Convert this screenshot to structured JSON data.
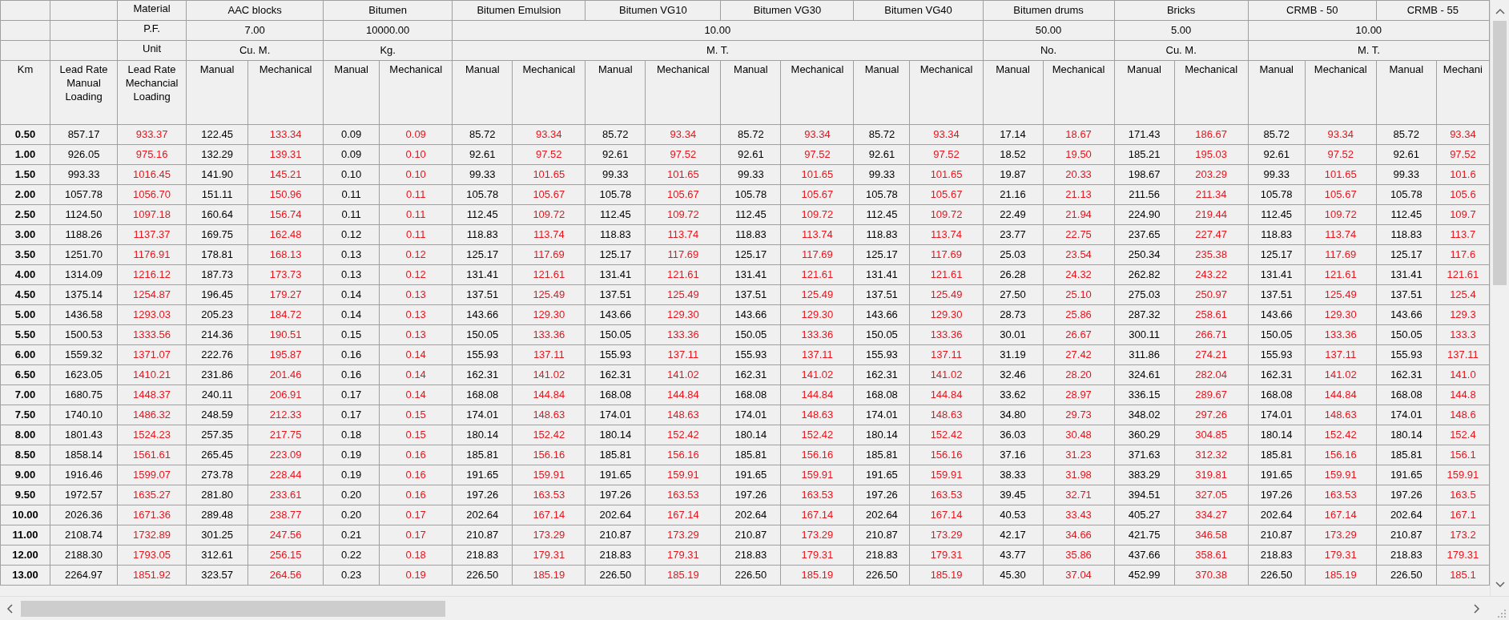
{
  "header_labels": {
    "material": "Material",
    "pf": "P.F.",
    "unit": "Unit"
  },
  "material_groups": [
    {
      "pf": "7.00",
      "unit": "Cu. M.",
      "materials": [
        {
          "name": "AAC blocks"
        }
      ]
    },
    {
      "pf": "10000.00",
      "unit": "Kg.",
      "materials": [
        {
          "name": "Bitumen"
        }
      ]
    },
    {
      "pf": "10.00",
      "unit": "M. T.",
      "materials": [
        {
          "name": "Bitumen Emulsion"
        },
        {
          "name": "Bitumen VG10"
        },
        {
          "name": "Bitumen VG30"
        },
        {
          "name": "Bitumen VG40"
        }
      ]
    },
    {
      "pf": "50.00",
      "unit": "No.",
      "materials": [
        {
          "name": "Bitumen drums"
        }
      ]
    },
    {
      "pf": "5.00",
      "unit": "Cu. M.",
      "materials": [
        {
          "name": "Bricks"
        }
      ]
    },
    {
      "pf": "10.00",
      "unit": "M. T.",
      "materials": [
        {
          "name": "CRMB - 50"
        },
        {
          "name": "CRMB - 55"
        }
      ]
    }
  ],
  "columns": [
    {
      "label": "Km",
      "kind": "key"
    },
    {
      "label": "Lead Rate Manual Loading",
      "kind": "manual"
    },
    {
      "label": "Lead Rate Mechancial Loading",
      "kind": "mechanical"
    },
    {
      "label": "Manual",
      "kind": "manual"
    },
    {
      "label": "Mechanical",
      "kind": "mechanical"
    },
    {
      "label": "Manual",
      "kind": "manual"
    },
    {
      "label": "Mechanical",
      "kind": "mechanical"
    },
    {
      "label": "Manual",
      "kind": "manual"
    },
    {
      "label": "Mechanical",
      "kind": "mechanical"
    },
    {
      "label": "Manual",
      "kind": "manual"
    },
    {
      "label": "Mechanical",
      "kind": "mechanical"
    },
    {
      "label": "Manual",
      "kind": "manual"
    },
    {
      "label": "Mechanical",
      "kind": "mechanical"
    },
    {
      "label": "Manual",
      "kind": "manual"
    },
    {
      "label": "Mechanical",
      "kind": "mechanical"
    },
    {
      "label": "Manual",
      "kind": "manual"
    },
    {
      "label": "Mechanical",
      "kind": "mechanical"
    },
    {
      "label": "Manual",
      "kind": "manual"
    },
    {
      "label": "Mechanical",
      "kind": "mechanical"
    },
    {
      "label": "Manual",
      "kind": "manual"
    },
    {
      "label": "Mechanical",
      "kind": "mechanical"
    },
    {
      "label": "Manual",
      "kind": "manual"
    },
    {
      "label": "Mechani",
      "kind": "mechanical"
    }
  ],
  "rows": [
    [
      "0.50",
      "857.17",
      "933.37",
      "122.45",
      "133.34",
      "0.09",
      "0.09",
      "85.72",
      "93.34",
      "85.72",
      "93.34",
      "85.72",
      "93.34",
      "85.72",
      "93.34",
      "17.14",
      "18.67",
      "171.43",
      "186.67",
      "85.72",
      "93.34",
      "85.72",
      "93.34"
    ],
    [
      "1.00",
      "926.05",
      "975.16",
      "132.29",
      "139.31",
      "0.09",
      "0.10",
      "92.61",
      "97.52",
      "92.61",
      "97.52",
      "92.61",
      "97.52",
      "92.61",
      "97.52",
      "18.52",
      "19.50",
      "185.21",
      "195.03",
      "92.61",
      "97.52",
      "92.61",
      "97.52"
    ],
    [
      "1.50",
      "993.33",
      "1016.45",
      "141.90",
      "145.21",
      "0.10",
      "0.10",
      "99.33",
      "101.65",
      "99.33",
      "101.65",
      "99.33",
      "101.65",
      "99.33",
      "101.65",
      "19.87",
      "20.33",
      "198.67",
      "203.29",
      "99.33",
      "101.65",
      "99.33",
      "101.6"
    ],
    [
      "2.00",
      "1057.78",
      "1056.70",
      "151.11",
      "150.96",
      "0.11",
      "0.11",
      "105.78",
      "105.67",
      "105.78",
      "105.67",
      "105.78",
      "105.67",
      "105.78",
      "105.67",
      "21.16",
      "21.13",
      "211.56",
      "211.34",
      "105.78",
      "105.67",
      "105.78",
      "105.6"
    ],
    [
      "2.50",
      "1124.50",
      "1097.18",
      "160.64",
      "156.74",
      "0.11",
      "0.11",
      "112.45",
      "109.72",
      "112.45",
      "109.72",
      "112.45",
      "109.72",
      "112.45",
      "109.72",
      "22.49",
      "21.94",
      "224.90",
      "219.44",
      "112.45",
      "109.72",
      "112.45",
      "109.7"
    ],
    [
      "3.00",
      "1188.26",
      "1137.37",
      "169.75",
      "162.48",
      "0.12",
      "0.11",
      "118.83",
      "113.74",
      "118.83",
      "113.74",
      "118.83",
      "113.74",
      "118.83",
      "113.74",
      "23.77",
      "22.75",
      "237.65",
      "227.47",
      "118.83",
      "113.74",
      "118.83",
      "113.7"
    ],
    [
      "3.50",
      "1251.70",
      "1176.91",
      "178.81",
      "168.13",
      "0.13",
      "0.12",
      "125.17",
      "117.69",
      "125.17",
      "117.69",
      "125.17",
      "117.69",
      "125.17",
      "117.69",
      "25.03",
      "23.54",
      "250.34",
      "235.38",
      "125.17",
      "117.69",
      "125.17",
      "117.6"
    ],
    [
      "4.00",
      "1314.09",
      "1216.12",
      "187.73",
      "173.73",
      "0.13",
      "0.12",
      "131.41",
      "121.61",
      "131.41",
      "121.61",
      "131.41",
      "121.61",
      "131.41",
      "121.61",
      "26.28",
      "24.32",
      "262.82",
      "243.22",
      "131.41",
      "121.61",
      "131.41",
      "121.61"
    ],
    [
      "4.50",
      "1375.14",
      "1254.87",
      "196.45",
      "179.27",
      "0.14",
      "0.13",
      "137.51",
      "125.49",
      "137.51",
      "125.49",
      "137.51",
      "125.49",
      "137.51",
      "125.49",
      "27.50",
      "25.10",
      "275.03",
      "250.97",
      "137.51",
      "125.49",
      "137.51",
      "125.4"
    ],
    [
      "5.00",
      "1436.58",
      "1293.03",
      "205.23",
      "184.72",
      "0.14",
      "0.13",
      "143.66",
      "129.30",
      "143.66",
      "129.30",
      "143.66",
      "129.30",
      "143.66",
      "129.30",
      "28.73",
      "25.86",
      "287.32",
      "258.61",
      "143.66",
      "129.30",
      "143.66",
      "129.3"
    ],
    [
      "5.50",
      "1500.53",
      "1333.56",
      "214.36",
      "190.51",
      "0.15",
      "0.13",
      "150.05",
      "133.36",
      "150.05",
      "133.36",
      "150.05",
      "133.36",
      "150.05",
      "133.36",
      "30.01",
      "26.67",
      "300.11",
      "266.71",
      "150.05",
      "133.36",
      "150.05",
      "133.3"
    ],
    [
      "6.00",
      "1559.32",
      "1371.07",
      "222.76",
      "195.87",
      "0.16",
      "0.14",
      "155.93",
      "137.11",
      "155.93",
      "137.11",
      "155.93",
      "137.11",
      "155.93",
      "137.11",
      "31.19",
      "27.42",
      "311.86",
      "274.21",
      "155.93",
      "137.11",
      "155.93",
      "137.11"
    ],
    [
      "6.50",
      "1623.05",
      "1410.21",
      "231.86",
      "201.46",
      "0.16",
      "0.14",
      "162.31",
      "141.02",
      "162.31",
      "141.02",
      "162.31",
      "141.02",
      "162.31",
      "141.02",
      "32.46",
      "28.20",
      "324.61",
      "282.04",
      "162.31",
      "141.02",
      "162.31",
      "141.0"
    ],
    [
      "7.00",
      "1680.75",
      "1448.37",
      "240.11",
      "206.91",
      "0.17",
      "0.14",
      "168.08",
      "144.84",
      "168.08",
      "144.84",
      "168.08",
      "144.84",
      "168.08",
      "144.84",
      "33.62",
      "28.97",
      "336.15",
      "289.67",
      "168.08",
      "144.84",
      "168.08",
      "144.8"
    ],
    [
      "7.50",
      "1740.10",
      "1486.32",
      "248.59",
      "212.33",
      "0.17",
      "0.15",
      "174.01",
      "148.63",
      "174.01",
      "148.63",
      "174.01",
      "148.63",
      "174.01",
      "148.63",
      "34.80",
      "29.73",
      "348.02",
      "297.26",
      "174.01",
      "148.63",
      "174.01",
      "148.6"
    ],
    [
      "8.00",
      "1801.43",
      "1524.23",
      "257.35",
      "217.75",
      "0.18",
      "0.15",
      "180.14",
      "152.42",
      "180.14",
      "152.42",
      "180.14",
      "152.42",
      "180.14",
      "152.42",
      "36.03",
      "30.48",
      "360.29",
      "304.85",
      "180.14",
      "152.42",
      "180.14",
      "152.4"
    ],
    [
      "8.50",
      "1858.14",
      "1561.61",
      "265.45",
      "223.09",
      "0.19",
      "0.16",
      "185.81",
      "156.16",
      "185.81",
      "156.16",
      "185.81",
      "156.16",
      "185.81",
      "156.16",
      "37.16",
      "31.23",
      "371.63",
      "312.32",
      "185.81",
      "156.16",
      "185.81",
      "156.1"
    ],
    [
      "9.00",
      "1916.46",
      "1599.07",
      "273.78",
      "228.44",
      "0.19",
      "0.16",
      "191.65",
      "159.91",
      "191.65",
      "159.91",
      "191.65",
      "159.91",
      "191.65",
      "159.91",
      "38.33",
      "31.98",
      "383.29",
      "319.81",
      "191.65",
      "159.91",
      "191.65",
      "159.91"
    ],
    [
      "9.50",
      "1972.57",
      "1635.27",
      "281.80",
      "233.61",
      "0.20",
      "0.16",
      "197.26",
      "163.53",
      "197.26",
      "163.53",
      "197.26",
      "163.53",
      "197.26",
      "163.53",
      "39.45",
      "32.71",
      "394.51",
      "327.05",
      "197.26",
      "163.53",
      "197.26",
      "163.5"
    ],
    [
      "10.00",
      "2026.36",
      "1671.36",
      "289.48",
      "238.77",
      "0.20",
      "0.17",
      "202.64",
      "167.14",
      "202.64",
      "167.14",
      "202.64",
      "167.14",
      "202.64",
      "167.14",
      "40.53",
      "33.43",
      "405.27",
      "334.27",
      "202.64",
      "167.14",
      "202.64",
      "167.1"
    ],
    [
      "11.00",
      "2108.74",
      "1732.89",
      "301.25",
      "247.56",
      "0.21",
      "0.17",
      "210.87",
      "173.29",
      "210.87",
      "173.29",
      "210.87",
      "173.29",
      "210.87",
      "173.29",
      "42.17",
      "34.66",
      "421.75",
      "346.58",
      "210.87",
      "173.29",
      "210.87",
      "173.2"
    ],
    [
      "12.00",
      "2188.30",
      "1793.05",
      "312.61",
      "256.15",
      "0.22",
      "0.18",
      "218.83",
      "179.31",
      "218.83",
      "179.31",
      "218.83",
      "179.31",
      "218.83",
      "179.31",
      "43.77",
      "35.86",
      "437.66",
      "358.61",
      "218.83",
      "179.31",
      "218.83",
      "179.31"
    ],
    [
      "13.00",
      "2264.97",
      "1851.92",
      "323.57",
      "264.56",
      "0.23",
      "0.19",
      "226.50",
      "185.19",
      "226.50",
      "185.19",
      "226.50",
      "185.19",
      "226.50",
      "185.19",
      "45.30",
      "37.04",
      "452.99",
      "370.38",
      "226.50",
      "185.19",
      "226.50",
      "185.1"
    ]
  ]
}
